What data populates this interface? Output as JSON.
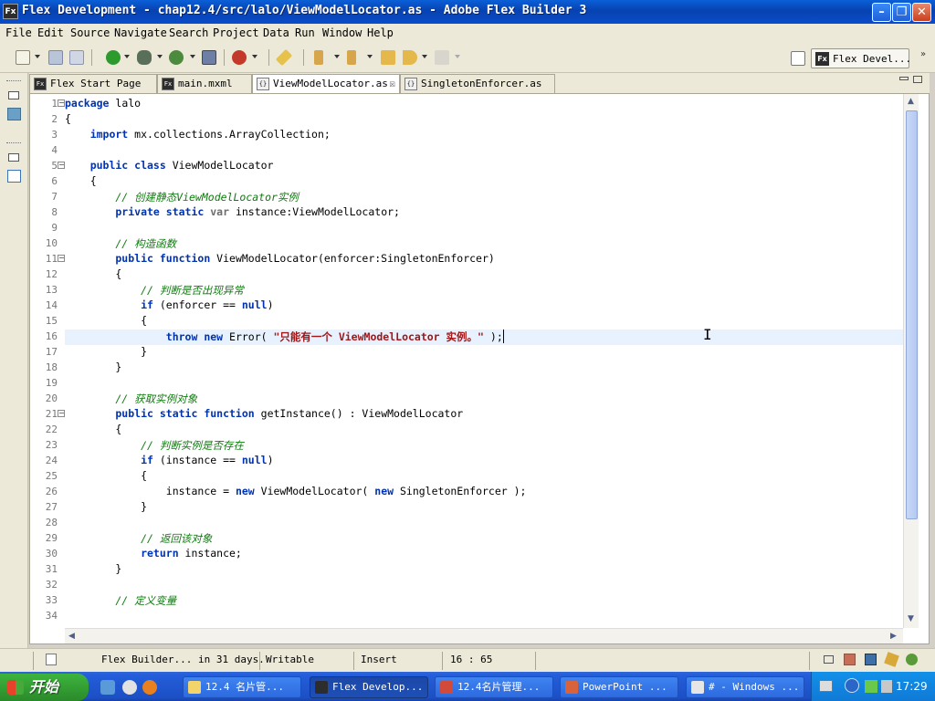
{
  "window": {
    "title": "Flex Development - chap12.4/src/lalo/ViewModelLocator.as - Adobe Flex Builder 3",
    "app_icon": "Fx"
  },
  "menu": [
    "File",
    "Edit",
    "Source",
    "Navigate",
    "Search",
    "Project",
    "Data",
    "Run",
    "Window",
    "Help"
  ],
  "perspective": {
    "label": "Flex Devel...",
    "icon": "Fx"
  },
  "tabs": [
    {
      "label": "Flex Start Page",
      "icon": "Fx"
    },
    {
      "label": "main.mxml",
      "icon": "Fx"
    },
    {
      "label": "ViewModelLocator.as",
      "icon": "{}",
      "close": "☒"
    },
    {
      "label": "SingletonEnforcer.as",
      "icon": "{}"
    }
  ],
  "code_lines": [
    "1",
    "2",
    "3",
    "4",
    "5",
    "6",
    "7",
    "8",
    "9",
    "10",
    "11",
    "12",
    "13",
    "14",
    "15",
    "16",
    "17",
    "18",
    "19",
    "20",
    "21",
    "22",
    "23",
    "24",
    "25",
    "26",
    "27",
    "28",
    "29",
    "30",
    "31",
    "32",
    "33",
    "34"
  ],
  "code": {
    "l1a": "package",
    "l1b": " lalo",
    "l2": "{",
    "l3a": "    import",
    "l3b": " mx.collections.ArrayCollection;",
    "l5a": "    public class",
    "l5b": " ViewModelLocator",
    "l6": "    {",
    "l7": "        // 创建静态ViewModelLocator实例",
    "l8a": "        private static",
    "l8b": " var",
    "l8c": " instance:ViewModelLocator;",
    "l10": "        // 构造函数",
    "l11a": "        public function",
    "l11b": " ViewModelLocator(enforcer:SingletonEnforcer)",
    "l12": "        {",
    "l13": "            // 判断是否出现异常",
    "l14a": "            if",
    "l14b": " (enforcer == ",
    "l14c": "null",
    "l14d": ")",
    "l15": "            {",
    "l16a": "                throw new",
    "l16b": " Error( ",
    "l16c": "\"只能有一个 ViewModelLocator 实例。\"",
    "l16d": " );",
    "l17": "            }",
    "l18": "        }",
    "l20": "        // 获取实例对象",
    "l21a": "        public static function",
    "l21b": " getInstance() : ViewModelLocator",
    "l22": "        {",
    "l23": "            // 判断实例是否存在",
    "l24a": "            if",
    "l24b": " (instance == ",
    "l24c": "null",
    "l24d": ")",
    "l25": "            {",
    "l26a": "                instance = ",
    "l26b": "new",
    "l26c": " ViewModelLocator( ",
    "l26d": "new",
    "l26e": " SingletonEnforcer );",
    "l27": "            }",
    "l29": "            // 返回该对象",
    "l30a": "            return",
    "l30b": " instance;",
    "l31": "        }",
    "l33": "        // 定义变量"
  },
  "status": {
    "message": "Flex Builder... in 31 days.",
    "mode": "Writable",
    "insert": "Insert",
    "position": "16 : 65"
  },
  "taskbar": {
    "start": "开始",
    "tasks": [
      "12.4 名片管...",
      "Flex Develop...",
      "12.4名片管理...",
      "PowerPoint ...",
      "# - Windows ..."
    ],
    "clock": "17:29"
  }
}
